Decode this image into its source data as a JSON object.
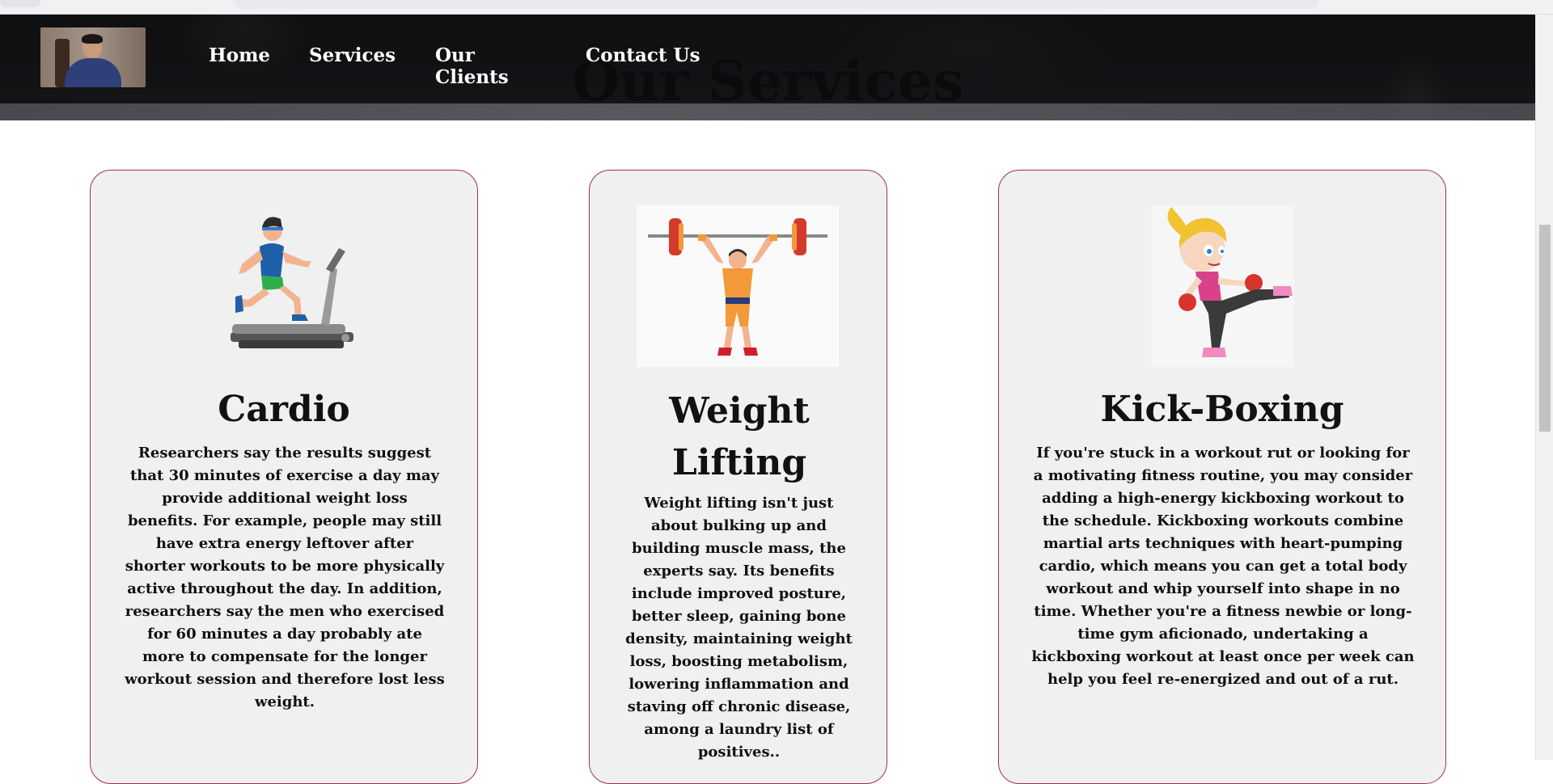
{
  "nav": {
    "items": [
      {
        "label": "Home"
      },
      {
        "label": "Services"
      },
      {
        "label": "Our Clients"
      },
      {
        "label": "Contact Us"
      }
    ]
  },
  "section": {
    "title": "Our Services"
  },
  "cards": [
    {
      "title": "Cardio",
      "image": "treadmill-runner-illustration",
      "text": "Researchers say the results suggest that 30 minutes of exercise a day may provide additional weight loss benefits. For example, people may still have extra energy leftover after shorter workouts to be more physically active throughout the day. In addition, researchers say the men who exercised for 60 minutes a day probably ate more to compensate for the longer workout session and therefore lost less weight."
    },
    {
      "title": "Weight Lifting",
      "image": "weightlifter-illustration",
      "text": "Weight lifting isn't just about bulking up and building muscle mass, the experts say. Its benefits include improved posture, better sleep, gaining bone density, maintaining weight loss, boosting metabolism, lowering inflammation and staving off chronic disease, among a laundry list of positives.."
    },
    {
      "title": "Kick-Boxing",
      "image": "kickboxer-illustration",
      "text": "If you're stuck in a workout rut or looking for a motivating fitness routine, you may consider adding a high-energy kickboxing workout to the schedule. Kickboxing workouts combine martial arts techniques with heart-pumping cardio, which means you can get a total body workout and whip yourself into shape in no time. Whether you're a fitness newbie or long-time gym aficionado, undertaking a kickboxing workout at least once per week can help you feel re-energized and out of a rut."
    }
  ],
  "colors": {
    "card_border": "#a3343a",
    "card_bg": "#f0f0f0",
    "nav_bg": "#0c0c0e"
  }
}
